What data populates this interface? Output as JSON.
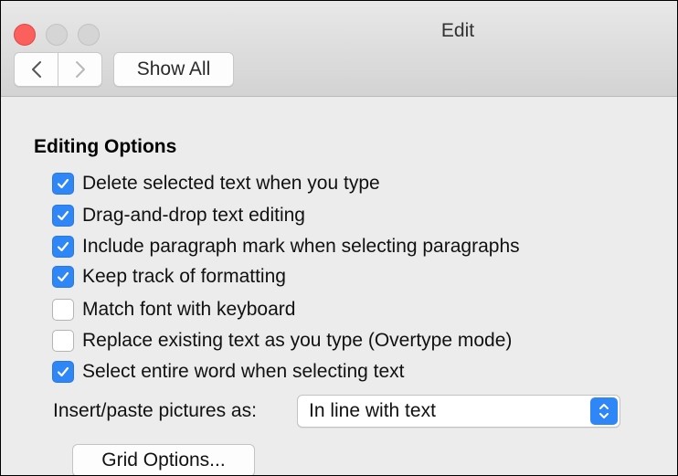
{
  "window": {
    "title": "Edit"
  },
  "toolbar": {
    "show_all_label": "Show All",
    "back_icon": "chevron-left-icon",
    "forward_icon": "chevron-right-icon"
  },
  "editing_options": {
    "title": "Editing Options",
    "items": [
      {
        "label": "Delete selected text when you type",
        "checked": true
      },
      {
        "label": "Drag-and-drop text editing",
        "checked": true
      },
      {
        "label": "Include paragraph mark when selecting paragraphs",
        "checked": true
      },
      {
        "label": "Keep track of formatting",
        "checked": true
      },
      {
        "label": "Match font with keyboard",
        "checked": false
      },
      {
        "label": "Replace existing text as you type (Overtype mode)",
        "checked": false
      },
      {
        "label": "Select entire word when selecting text",
        "checked": true
      }
    ]
  },
  "insert_paste": {
    "label": "Insert/paste pictures as:",
    "selected": "In line with text"
  },
  "grid_options": {
    "label": "Grid Options..."
  },
  "colors": {
    "accent": "#2f86f6",
    "close_button": "#fc605c",
    "inactive_button": "#d5d5d5"
  }
}
